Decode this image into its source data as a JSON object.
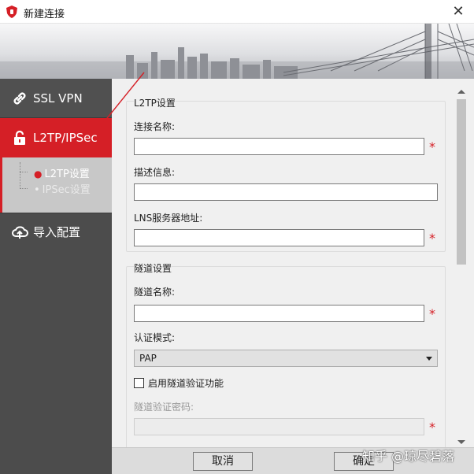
{
  "window": {
    "title": "新建连接",
    "close_glyph": "✕"
  },
  "sidebar": {
    "items": [
      {
        "label": "SSL VPN",
        "icon": "link-icon"
      },
      {
        "label": "L2TP/IPSec",
        "icon": "lock-open-icon",
        "active": true
      },
      {
        "label": "导入配置",
        "icon": "cloud-upload-icon"
      }
    ],
    "subitems": [
      {
        "label": "L2TP设置",
        "active": true
      },
      {
        "label": "IPSec设置",
        "active": false
      }
    ]
  },
  "l2tp": {
    "section_title": "L2TP设置",
    "name_label": "连接名称:",
    "name_value": "",
    "desc_label": "描述信息:",
    "desc_value": "",
    "lns_label": "LNS服务器地址:",
    "lns_value": ""
  },
  "tunnel": {
    "section_title": "隧道设置",
    "name_label": "隧道名称:",
    "name_value": "",
    "auth_label": "认证模式:",
    "auth_value": "PAP",
    "enable_label": "启用隧道验证功能",
    "enable_checked": false,
    "pwd_label": "隧道验证密码:",
    "pwd_value": ""
  },
  "required_mark": "*",
  "buttons": {
    "cancel": "取消",
    "ok": "确定"
  },
  "watermark": "知乎 @琼尽碧落",
  "colors": {
    "accent": "#d51f26",
    "sidebar": "#4c4c4c",
    "subnav": "#c8c8c8"
  }
}
